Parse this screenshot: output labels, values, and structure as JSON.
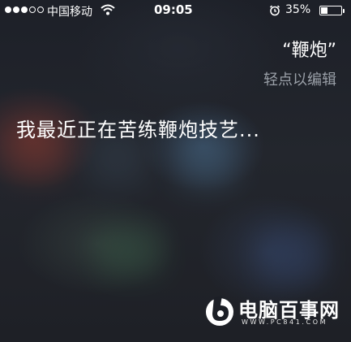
{
  "status_bar": {
    "carrier": "中国移动",
    "time": "09:05",
    "battery_percent": "35%",
    "battery_level": 0.35,
    "signal_bars_filled": 3,
    "signal_bars_total": 5,
    "icons": [
      "signal-dots-icon",
      "wifi-icon",
      "alarm-clock-icon",
      "battery-icon"
    ]
  },
  "siri": {
    "query": "“鞭炮”",
    "edit_hint": "轻点以编辑",
    "response": "我最近正在苦练鞭炮技艺..."
  },
  "watermark": {
    "name": "电脑百事网",
    "url": "WWW.PC841.COM"
  },
  "colors": {
    "text_primary": "#ffffff",
    "text_secondary": "#9aa0a8",
    "background": "#1c1f26"
  }
}
